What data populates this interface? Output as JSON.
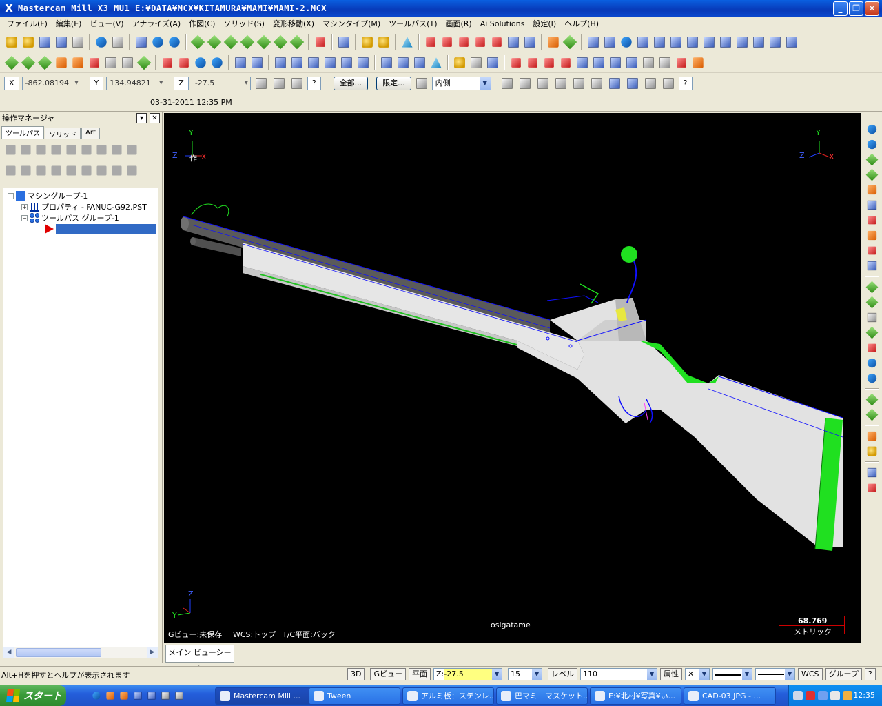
{
  "window": {
    "app_icon": "X",
    "title": "Mastercam Mill X3 MU1  E:¥DATA¥MCX¥KITAMURA¥MAMI¥MAMI-2.MCX",
    "minimize": "_",
    "restore": "❐",
    "close": "✕"
  },
  "menu": [
    "ファイル(F)",
    "編集(E)",
    "ビュー(V)",
    "アナライズ(A)",
    "作図(C)",
    "ソリッド(S)",
    "変形移動(X)",
    "マシンタイプ(M)",
    "ツールパス(T)",
    "画面(R)",
    "Ai Solutions",
    "設定(I)",
    "ヘルプ(H)"
  ],
  "coords": {
    "x_label": "X",
    "x_value": "-862.08194",
    "y_label": "Y",
    "y_value": "134.94821",
    "z_label": "Z",
    "z_value": "-27.5",
    "all_button": "全部...",
    "limit_button": "限定...",
    "mode_value": "内側",
    "help_icon": "?"
  },
  "date_line": "03-31-2011  12:35 PM",
  "opmgr": {
    "title": "操作マネージャ",
    "tabs": [
      "ツールパス",
      "ソリッド",
      "Art"
    ],
    "tree": {
      "machine_group": "マシングループ-1",
      "properties": "プロパティ - FANUC-G92.PST",
      "toolpath_group": "ツールパス グループ-1"
    }
  },
  "viewport": {
    "y_top_left": "Y",
    "z_top_left": "Z",
    "x_top_left": "X",
    "work_label": "作",
    "y_top_right": "Y",
    "z_top_right": "Z",
    "x_top_right": "X",
    "z_bottom": "Z",
    "y_bottom": "Y",
    "gview_label": "Gビュー:未保存",
    "wcs_label": "WCS:トップ",
    "tc_label": "T/C平面:バック",
    "center_label": "osigatame",
    "scale_value": "68.769",
    "scale_unit": "メトリック",
    "colors": {
      "background": "#000000",
      "body": "#e8e8e8",
      "edge": "#1010ff",
      "green": "#20e020"
    }
  },
  "sheet_tab": "メイン ビューシート",
  "status": {
    "hint": "Alt+Hを押すとヘルプが表示されます",
    "btn_3d": "3D",
    "btn_gview": "Gビュー",
    "btn_plane": "平面",
    "z_label": "Z:",
    "z_value": "-27.5",
    "num_value": "15",
    "level_label": "レベル",
    "level_value": "110",
    "attr_label": "属性",
    "wcs": "WCS",
    "group": "グループ",
    "q": "?"
  },
  "taskbar": {
    "start": "スタート",
    "tasks": [
      "Mastercam Mill ...",
      "Tween",
      "アルミ板：ステンレ...",
      "巴マミ　マスケット...",
      "E:¥北村¥写真¥い...",
      "CAD-03.JPG - ..."
    ],
    "clock": "12:35"
  }
}
